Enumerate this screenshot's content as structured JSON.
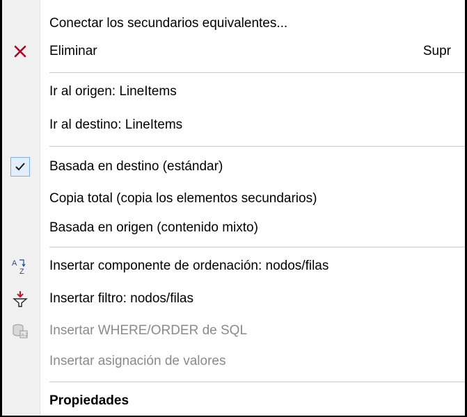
{
  "menu": {
    "items": [
      {
        "label": "Conectar los secundarios equivalentes...",
        "icon": null
      },
      {
        "label": "Eliminar",
        "shortcut": "Supr",
        "icon": "delete-x-icon"
      },
      {
        "label": "Ir al origen: LineItems"
      },
      {
        "label": "Ir al destino: LineItems"
      },
      {
        "label": "Basada en destino (estándar)",
        "checked": true,
        "icon": "checkmark-icon"
      },
      {
        "label": "Copia total (copia los elementos secundarios)"
      },
      {
        "label": "Basada en origen (contenido mixto)"
      },
      {
        "label": "Insertar componente de ordenación: nodos/filas",
        "icon": "sort-az-icon"
      },
      {
        "label": "Insertar filtro: nodos/filas",
        "icon": "filter-icon"
      },
      {
        "label": "Insertar WHERE/ORDER de SQL",
        "disabled": true,
        "icon": "sql-where-icon"
      },
      {
        "label": "Insertar asignación de valores",
        "disabled": true
      },
      {
        "label": "Propiedades",
        "bold": true
      }
    ]
  },
  "colors": {
    "delete_icon": "#b00020",
    "filter_icon": "#c8102e",
    "check_bg": "#e2eefb",
    "check_border": "#7fb3e8",
    "disabled_text": "#8a8a8a"
  }
}
